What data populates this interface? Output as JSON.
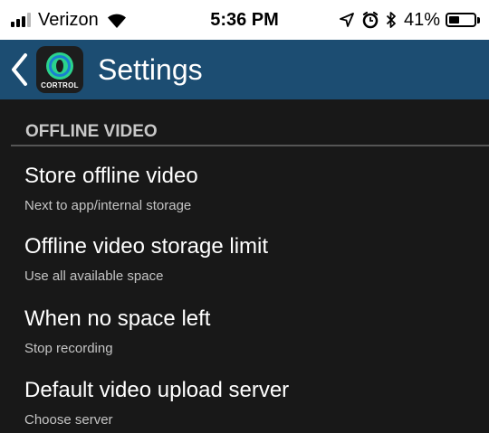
{
  "status_bar": {
    "carrier": "Verizon",
    "time": "5:36 PM",
    "battery_percent": "41%",
    "battery_level": 0.41,
    "signal_bars_filled": 3,
    "signal_bars_total": 4,
    "icons": [
      "signal-icon",
      "wifi-icon",
      "location-arrow-icon",
      "alarm-icon",
      "bluetooth-icon",
      "battery-icon"
    ]
  },
  "app_bar": {
    "title": "Settings",
    "logo_text": "CORTROL",
    "back_icon": "chevron-left-icon",
    "color": "#1c4d72"
  },
  "section": {
    "title": "OFFLINE VIDEO"
  },
  "settings": [
    {
      "title": "Store offline video",
      "subtitle": "Next to app/internal storage"
    },
    {
      "title": "Offline video storage limit",
      "subtitle": "Use all available space"
    },
    {
      "title": "When no space left",
      "subtitle": "Stop recording"
    },
    {
      "title": "Default video upload server",
      "subtitle": "Choose server"
    }
  ],
  "colors": {
    "background": "#181818",
    "app_bar": "#1c4d72",
    "logo_accent": "#2bd38c"
  }
}
